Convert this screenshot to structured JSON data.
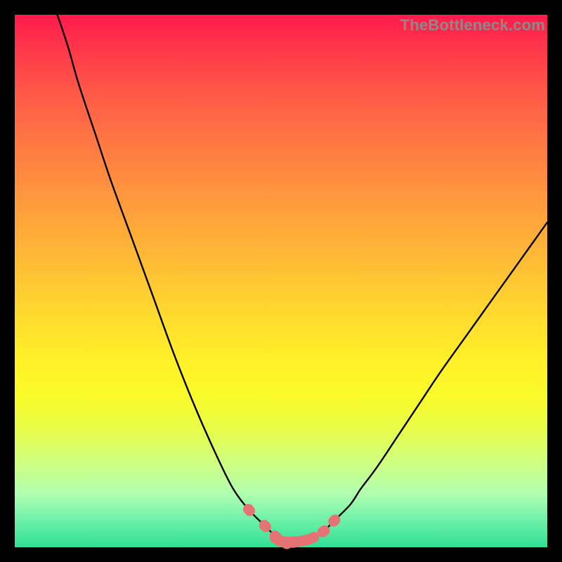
{
  "watermark": "TheBottleneck.com",
  "colors": {
    "frame": "#000000",
    "gradient_top": "#ff1a4b",
    "gradient_bottom": "#2fe095",
    "curve": "#000000",
    "marker": "#e57373"
  },
  "chart_data": {
    "type": "line",
    "title": "",
    "xlabel": "",
    "ylabel": "",
    "xlim": [
      0,
      100
    ],
    "ylim": [
      0,
      100
    ],
    "grid": false,
    "legend": false,
    "series": [
      {
        "name": "bottleneck-curve",
        "x": [
          8,
          10,
          12,
          15,
          18,
          22,
          26,
          30,
          34,
          38,
          41,
          44,
          47,
          49,
          50,
          51,
          52,
          54,
          56,
          58,
          60,
          63,
          65,
          68,
          72,
          76,
          80,
          85,
          90,
          95,
          100
        ],
        "values": [
          100,
          94,
          87,
          78,
          69,
          58,
          47,
          36,
          26,
          17,
          11,
          7,
          4,
          2,
          1.2,
          1,
          1,
          1.2,
          1.8,
          3,
          5,
          8,
          11,
          15,
          21,
          27,
          33,
          40,
          47,
          54,
          61
        ]
      }
    ],
    "markers": [
      {
        "x": 44,
        "y": 7
      },
      {
        "x": 47,
        "y": 4
      },
      {
        "x": 49,
        "y": 2
      },
      {
        "x": 50,
        "y": 1.2
      },
      {
        "x": 51,
        "y": 1
      },
      {
        "x": 52,
        "y": 1
      },
      {
        "x": 54,
        "y": 1.2
      },
      {
        "x": 56,
        "y": 1.8
      },
      {
        "x": 58,
        "y": 3
      },
      {
        "x": 60,
        "y": 5
      }
    ]
  }
}
